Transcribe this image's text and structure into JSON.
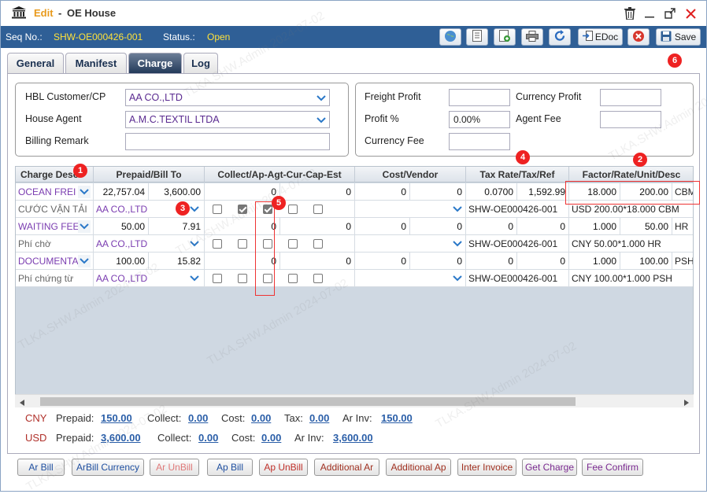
{
  "title": {
    "mode": "Edit",
    "separator": "-",
    "name": "OE House"
  },
  "header": {
    "seq_label": "Seq No.:",
    "seq_value": "SHW-OE000426-001",
    "status_label": "Status.:",
    "status_value": "Open",
    "edoc_label": "EDoc",
    "save_label": "Save"
  },
  "tabs": [
    {
      "label": "General"
    },
    {
      "label": "Manifest"
    },
    {
      "label": "Charge"
    },
    {
      "label": "Log"
    }
  ],
  "form": {
    "hbl_customer_label": "HBL Customer/CP",
    "hbl_customer_value": "AA CO.,LTD",
    "house_agent_label": "House Agent",
    "house_agent_value": "A.M.C.TEXTIL LTDA",
    "billing_remark_label": "Billing Remark",
    "billing_remark_value": "",
    "freight_profit_label": "Freight Profit",
    "freight_profit_value": "",
    "profit_pct_label": "Profit %",
    "profit_pct_value": "0.00%",
    "currency_fee_label": "Currency Fee",
    "currency_fee_value": "",
    "currency_profit_label": "Currency Profit",
    "currency_profit_value": "",
    "agent_fee_label": "Agent Fee",
    "agent_fee_value": ""
  },
  "grid": {
    "headers": [
      "Charge Desc",
      "Prepaid/Bill To",
      "Collect/Ap-Agt-Cur-Cap-Est",
      "Cost/Vendor",
      "Tax Rate/Tax/Ref",
      "Factor/Rate/Unit/Desc"
    ],
    "rows": [
      {
        "kind": "main",
        "desc": "OCEAN FREI",
        "prepaid": "22,757.04",
        "billto": "3,600.00",
        "collect1": "0",
        "collect2": "0",
        "cost1": "0",
        "cost2": "0",
        "taxrate": "0.0700",
        "tax": "1,592.99",
        "factor": "18.000",
        "rate": "200.00",
        "unit": "CBM"
      },
      {
        "kind": "sub",
        "desc": "CƯỚC VẬN TẢI",
        "billto": "AA CO.,LTD",
        "checks": [
          false,
          true,
          true,
          false,
          false
        ],
        "ref": "SHW-OE000426-001",
        "descr": "USD 200.00*18.000 CBM"
      },
      {
        "kind": "main",
        "desc": "WAITING FEE",
        "prepaid": "50.00",
        "billto": "7.91",
        "collect1": "0",
        "collect2": "0",
        "cost1": "0",
        "cost2": "0",
        "taxrate": "0",
        "tax": "0",
        "factor": "1.000",
        "rate": "50.00",
        "unit": "HR"
      },
      {
        "kind": "sub",
        "desc": "Phí chờ",
        "billto": "AA CO.,LTD",
        "checks": [
          false,
          false,
          false,
          false,
          false
        ],
        "ref": "SHW-OE000426-001",
        "descr": "CNY 50.00*1.000 HR"
      },
      {
        "kind": "main",
        "desc": "DOCUMENTA",
        "prepaid": "100.00",
        "billto": "15.82",
        "collect1": "0",
        "collect2": "0",
        "cost1": "0",
        "cost2": "0",
        "taxrate": "0",
        "tax": "0",
        "factor": "1.000",
        "rate": "100.00",
        "unit": "PSH"
      },
      {
        "kind": "sub",
        "desc": "Phí chứng từ",
        "billto": "AA CO.,LTD",
        "checks": [
          false,
          false,
          false,
          false,
          false
        ],
        "ref": "SHW-OE000426-001",
        "descr": "CNY 100.00*1.000 PSH"
      }
    ]
  },
  "summary": {
    "cny": {
      "currency": "CNY",
      "prepaid_label": "Prepaid:",
      "prepaid": "150.00",
      "collect_label": "Collect:",
      "collect": "0.00",
      "cost_label": "Cost:",
      "cost": "0.00",
      "tax_label": "Tax:",
      "tax": "0.00",
      "arinv_label": "Ar Inv:",
      "arinv": "150.00"
    },
    "usd": {
      "currency": "USD",
      "prepaid_label": "Prepaid:",
      "prepaid": "3,600.00",
      "collect_label": "Collect:",
      "collect": "0.00",
      "cost_label": "Cost:",
      "cost": "0.00",
      "arinv_label": "Ar Inv:",
      "arinv": "3,600.00"
    }
  },
  "buttons": [
    "Ar Bill",
    "ArBill Currency",
    "Ar UnBill",
    "Ap Bill",
    "Ap UnBill",
    "Additional Ar",
    "Additional Ap",
    "Inter Invoice",
    "Get Charge",
    "Fee Confirm"
  ],
  "button_colors": [
    "#1f4fa0",
    "#1f4fa0",
    "#e07a7a",
    "#1f4fa0",
    "#c0302a",
    "#a03020",
    "#a03020",
    "#a03020",
    "#7a2a90",
    "#7a2a90"
  ],
  "badges": [
    "1",
    "2",
    "3",
    "4",
    "5",
    "6"
  ],
  "watermark": "TLKA.SHW.Admin 2024-07-02",
  "colors": {
    "header_bg": "#2f5f96",
    "accent_yellow": "#ffe23a",
    "edit_orange": "#e89a1c",
    "badge_red": "#e22"
  }
}
